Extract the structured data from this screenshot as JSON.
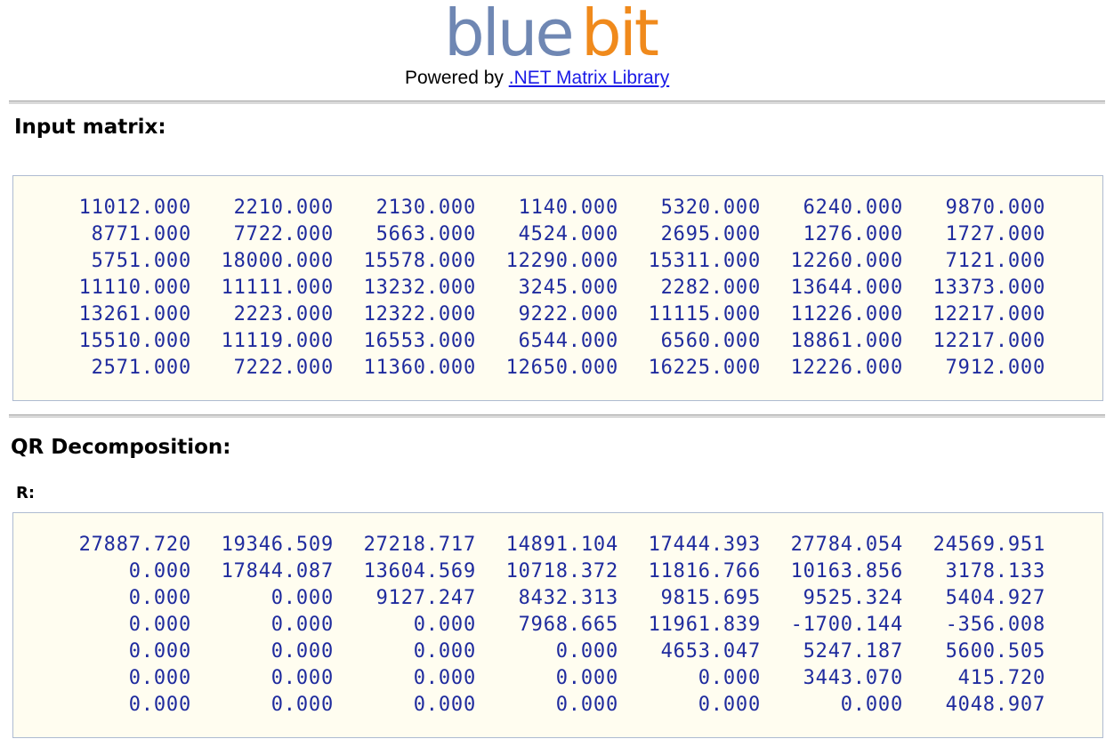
{
  "header": {
    "logo_text": "bluebit",
    "powered_prefix": "Powered by ",
    "powered_link": ".NET Matrix Library",
    "colors": {
      "blue": "#6f87b3",
      "orange": "#f08a1c",
      "link": "#1a1ae6"
    }
  },
  "input": {
    "title": "Input matrix:",
    "rows": [
      [
        "11012.000",
        "2210.000",
        "2130.000",
        "1140.000",
        "5320.000",
        "6240.000",
        "9870.000"
      ],
      [
        "8771.000",
        "7722.000",
        "5663.000",
        "4524.000",
        "2695.000",
        "1276.000",
        "1727.000"
      ],
      [
        "5751.000",
        "18000.000",
        "15578.000",
        "12290.000",
        "15311.000",
        "12260.000",
        "7121.000"
      ],
      [
        "11110.000",
        "11111.000",
        "13232.000",
        "3245.000",
        "2282.000",
        "13644.000",
        "13373.000"
      ],
      [
        "13261.000",
        "2223.000",
        "12322.000",
        "9222.000",
        "11115.000",
        "11226.000",
        "12217.000"
      ],
      [
        "15510.000",
        "11119.000",
        "16553.000",
        "6544.000",
        "6560.000",
        "18861.000",
        "12217.000"
      ],
      [
        "2571.000",
        "7222.000",
        "11360.000",
        "12650.000",
        "16225.000",
        "12226.000",
        "7912.000"
      ]
    ]
  },
  "qr": {
    "title": "QR Decomposition:",
    "r_label": "R:",
    "rows": [
      [
        "27887.720",
        "19346.509",
        "27218.717",
        "14891.104",
        "17444.393",
        "27784.054",
        "24569.951"
      ],
      [
        "0.000",
        "17844.087",
        "13604.569",
        "10718.372",
        "11816.766",
        "10163.856",
        "3178.133"
      ],
      [
        "0.000",
        "0.000",
        "9127.247",
        "8432.313",
        "9815.695",
        "9525.324",
        "5404.927"
      ],
      [
        "0.000",
        "0.000",
        "0.000",
        "7968.665",
        "11961.839",
        "-1700.144",
        "-356.008"
      ],
      [
        "0.000",
        "0.000",
        "0.000",
        "0.000",
        "4653.047",
        "5247.187",
        "5600.505"
      ],
      [
        "0.000",
        "0.000",
        "0.000",
        "0.000",
        "0.000",
        "3443.070",
        "415.720"
      ],
      [
        "0.000",
        "0.000",
        "0.000",
        "0.000",
        "0.000",
        "0.000",
        "4048.907"
      ]
    ]
  }
}
